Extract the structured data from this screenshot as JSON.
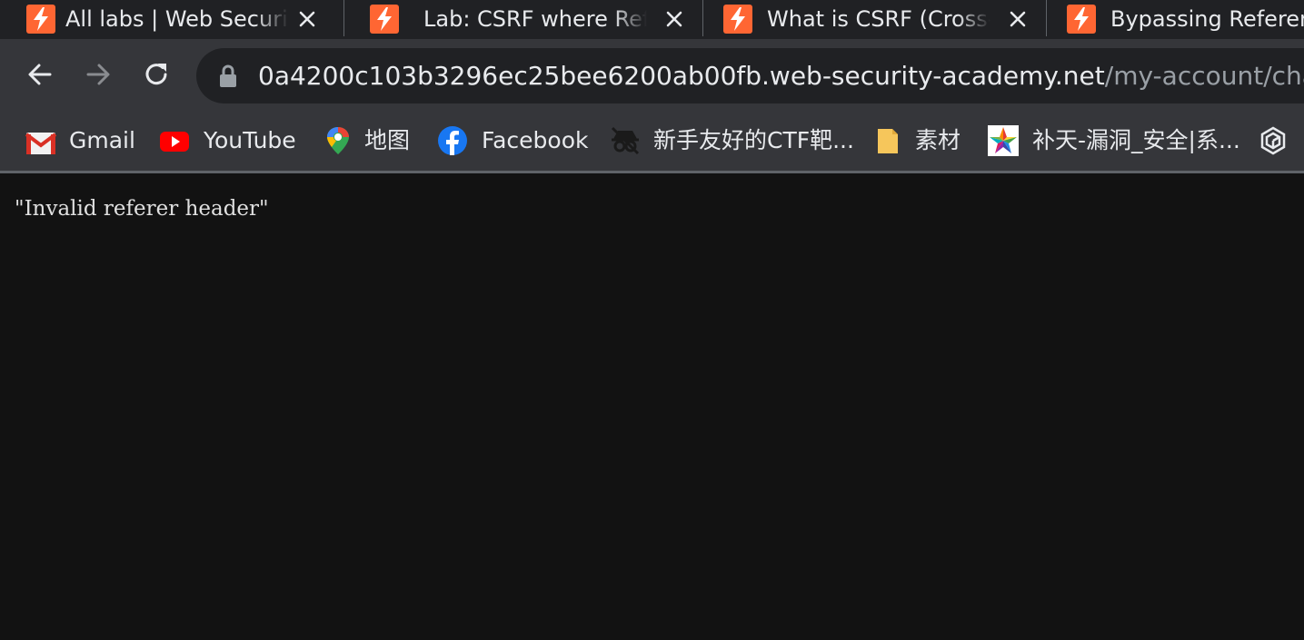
{
  "tabs": [
    {
      "title": "All labs | Web Security Academy",
      "favicon": "burp-lightning-icon"
    },
    {
      "title": "Lab: CSRF where Referer validation depends on header being present",
      "favicon": "burp-lightning-icon"
    },
    {
      "title": "What is CSRF (Cross-site request forgery)?",
      "favicon": "burp-lightning-icon"
    },
    {
      "title": "Bypassing Referer-based CSRF defenses",
      "favicon": "burp-lightning-icon"
    }
  ],
  "toolbar": {
    "back_icon": "arrow-left-icon",
    "forward_icon": "arrow-right-icon",
    "reload_icon": "reload-icon",
    "lock_icon": "lock-icon",
    "url_host": "0a4200c103b3296ec25bee6200ab00fb.web-security-academy.net",
    "url_path": "/my-account/change"
  },
  "bookmarks": [
    {
      "label": "Gmail",
      "icon": "gmail-icon"
    },
    {
      "label": "YouTube",
      "icon": "youtube-icon"
    },
    {
      "label": "地图",
      "icon": "maps-pin-icon"
    },
    {
      "label": "Facebook",
      "icon": "facebook-icon"
    },
    {
      "label": "新手友好的CTF靶...",
      "icon": "incognito-icon"
    },
    {
      "label": "素材",
      "icon": "folder-icon"
    },
    {
      "label": "补天-漏洞_安全|系...",
      "icon": "star-logo-icon"
    },
    {
      "label": "",
      "icon": "hexagon-logo-icon"
    }
  ],
  "page": {
    "message": "\"Invalid referer header\""
  },
  "colors": {
    "tabstrip_bg": "#202124",
    "toolbar_bg": "#35363a",
    "page_bg": "#121212",
    "burp_orange": "#ff6633"
  }
}
